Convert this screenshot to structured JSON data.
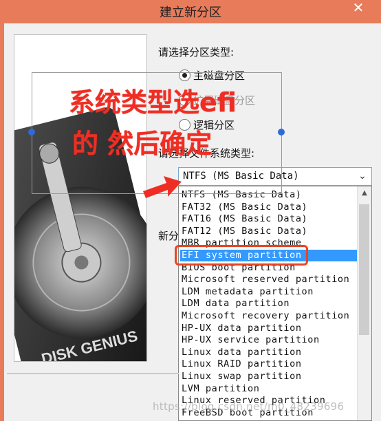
{
  "window": {
    "title": "建立新分区",
    "close": "✕"
  },
  "form": {
    "partition_type_label": "请选择分区类型:",
    "radio_primary": "主磁盘分区",
    "radio_extended": "扩展磁盘分区",
    "radio_logical": "逻辑分区",
    "fs_type_label": "请选择文件系统类型:",
    "new_size_label": "新分"
  },
  "select": {
    "value": "NTFS (MS Basic Data)",
    "options": [
      "NTFS (MS Basic Data)",
      "FAT32 (MS Basic Data)",
      "FAT16 (MS Basic Data)",
      "FAT12 (MS Basic Data)",
      "MBR partition scheme",
      "EFI system partition",
      "BIOS boot partition",
      "Microsoft reserved partition",
      "LDM metadata partition",
      "LDM data partition",
      "Microsoft recovery partition",
      "HP-UX data partition",
      "HP-UX service partition",
      "Linux data partition",
      "Linux RAID partition",
      "Linux swap partition",
      "LVM partition",
      "Linux reserved partition",
      "FreeBSD boot partition"
    ],
    "selected_index": 5
  },
  "annotation": {
    "line1": "系统类型选efi",
    "line2": "的 然后确定",
    "color": "#ee2e24"
  },
  "image": {
    "brand": "DISK GENIUS"
  },
  "watermark": "https://blog.csdn.net/m0_48239696"
}
